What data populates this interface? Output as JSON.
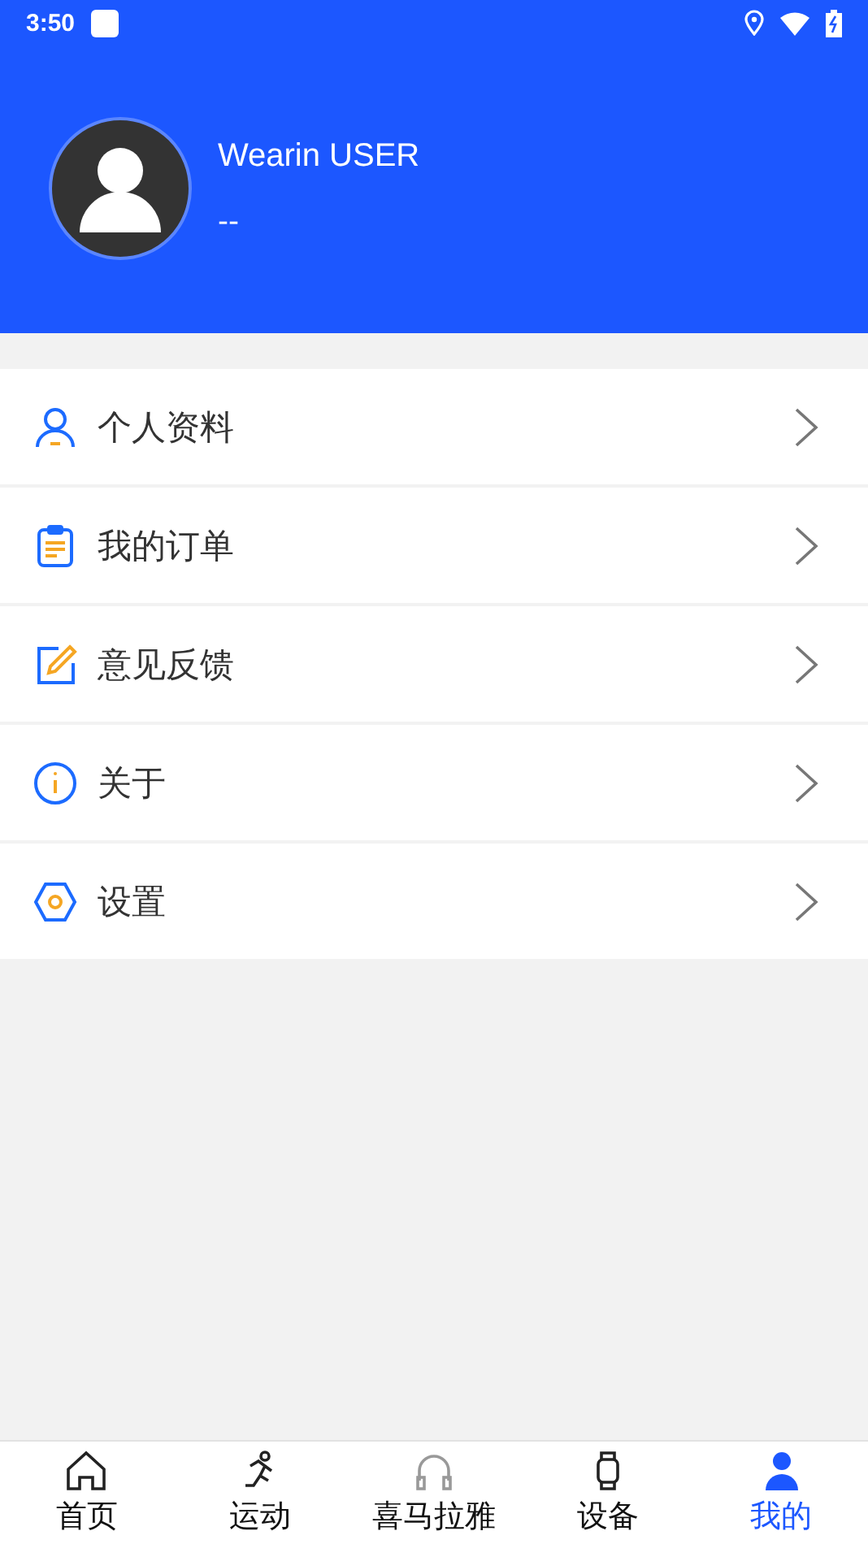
{
  "status_bar": {
    "time": "3:50"
  },
  "profile": {
    "name": "Wearin USER",
    "subtitle": "--"
  },
  "menu": [
    {
      "kind": "profile",
      "label": "个人资料"
    },
    {
      "kind": "orders",
      "label": "我的订单"
    },
    {
      "kind": "feedback",
      "label": "意见反馈"
    },
    {
      "kind": "about",
      "label": "关于"
    },
    {
      "kind": "settings",
      "label": "设置"
    }
  ],
  "tab_bar": [
    {
      "kind": "home",
      "label": "首页",
      "selected": false
    },
    {
      "kind": "sport",
      "label": "运动",
      "selected": false
    },
    {
      "kind": "listen",
      "label": "喜马拉雅",
      "selected": false
    },
    {
      "kind": "device",
      "label": "设备",
      "selected": false
    },
    {
      "kind": "me",
      "label": "我的",
      "selected": true
    }
  ]
}
